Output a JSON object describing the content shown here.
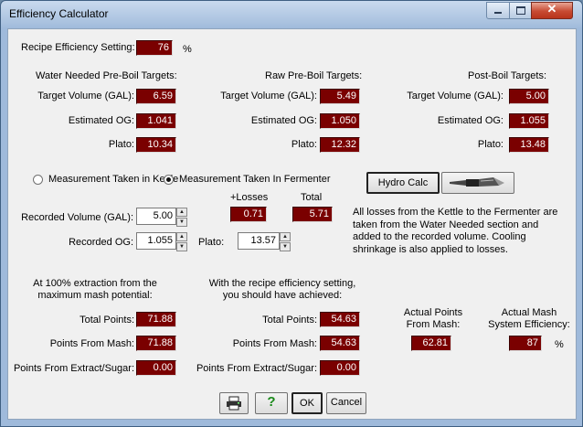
{
  "window": {
    "title": "Efficiency Calculator"
  },
  "recipe": {
    "label": "Recipe Efficiency Setting:",
    "value": "76",
    "unit": "%"
  },
  "water": {
    "heading": "Water Needed Pre-Boil Targets:",
    "target_volume_label": "Target Volume (GAL):",
    "target_volume": "6.59",
    "og_label": "Estimated OG:",
    "og": "1.041",
    "plato_label": "Plato:",
    "plato": "10.34"
  },
  "raw": {
    "heading": "Raw Pre-Boil Targets:",
    "target_volume_label": "Target Volume (GAL):",
    "target_volume": "5.49",
    "og_label": "Estimated OG:",
    "og": "1.050",
    "plato_label": "Plato:",
    "plato": "12.32"
  },
  "post": {
    "heading": "Post-Boil Targets:",
    "target_volume_label": "Target Volume (GAL):",
    "target_volume": "5.00",
    "og_label": "Estimated OG:",
    "og": "1.055",
    "plato_label": "Plato:",
    "plato": "13.48"
  },
  "measurement": {
    "kettle_label": "Measurement Taken in Kettle",
    "fermenter_label": "Measurement Taken In Fermenter",
    "selected": "fermenter",
    "losses_header": "+Losses",
    "total_header": "Total",
    "recorded_volume_label": "Recorded Volume (GAL):",
    "recorded_volume": "5.00",
    "losses": "0.71",
    "total": "5.71",
    "recorded_og_label": "Recorded OG:",
    "recorded_og": "1.055",
    "plato_label": "Plato:",
    "plato": "13.57"
  },
  "hydro": {
    "button_label": "Hydro Calc",
    "refractometer_icon": "refractometer-icon"
  },
  "note": "All losses from the Kettle to the Fermenter are taken from the Water Needed section and added to the recorded volume. Cooling shrinkage is also applied to losses.",
  "extraction": {
    "heading_line1": "At 100% extraction from the",
    "heading_line2": "maximum mash potential:",
    "total_points_label": "Total Points:",
    "total_points": "71.88",
    "points_mash_label": "Points From Mash:",
    "points_mash": "71.88",
    "points_extract_label": "Points From Extract/Sugar:",
    "points_extract": "0.00"
  },
  "achieved": {
    "heading_line1": "With the recipe efficiency setting,",
    "heading_line2": "you should have achieved:",
    "total_points_label": "Total Points:",
    "total_points": "54.63",
    "points_mash_label": "Points From Mash:",
    "points_mash": "54.63",
    "points_extract_label": "Points From Extract/Sugar:",
    "points_extract": "0.00"
  },
  "actual": {
    "points_label_line1": "Actual Points",
    "points_label_line2": "From Mash:",
    "points": "62.81",
    "eff_label_line1": "Actual Mash",
    "eff_label_line2": "System Efficiency:",
    "efficiency": "87",
    "unit": "%"
  },
  "buttons": {
    "print_icon": "printer-icon",
    "help_label": "?",
    "ok_label": "OK",
    "cancel_label": "Cancel"
  },
  "colors": {
    "value_bg": "#7a0000",
    "help_green": "#1a8a1a"
  }
}
